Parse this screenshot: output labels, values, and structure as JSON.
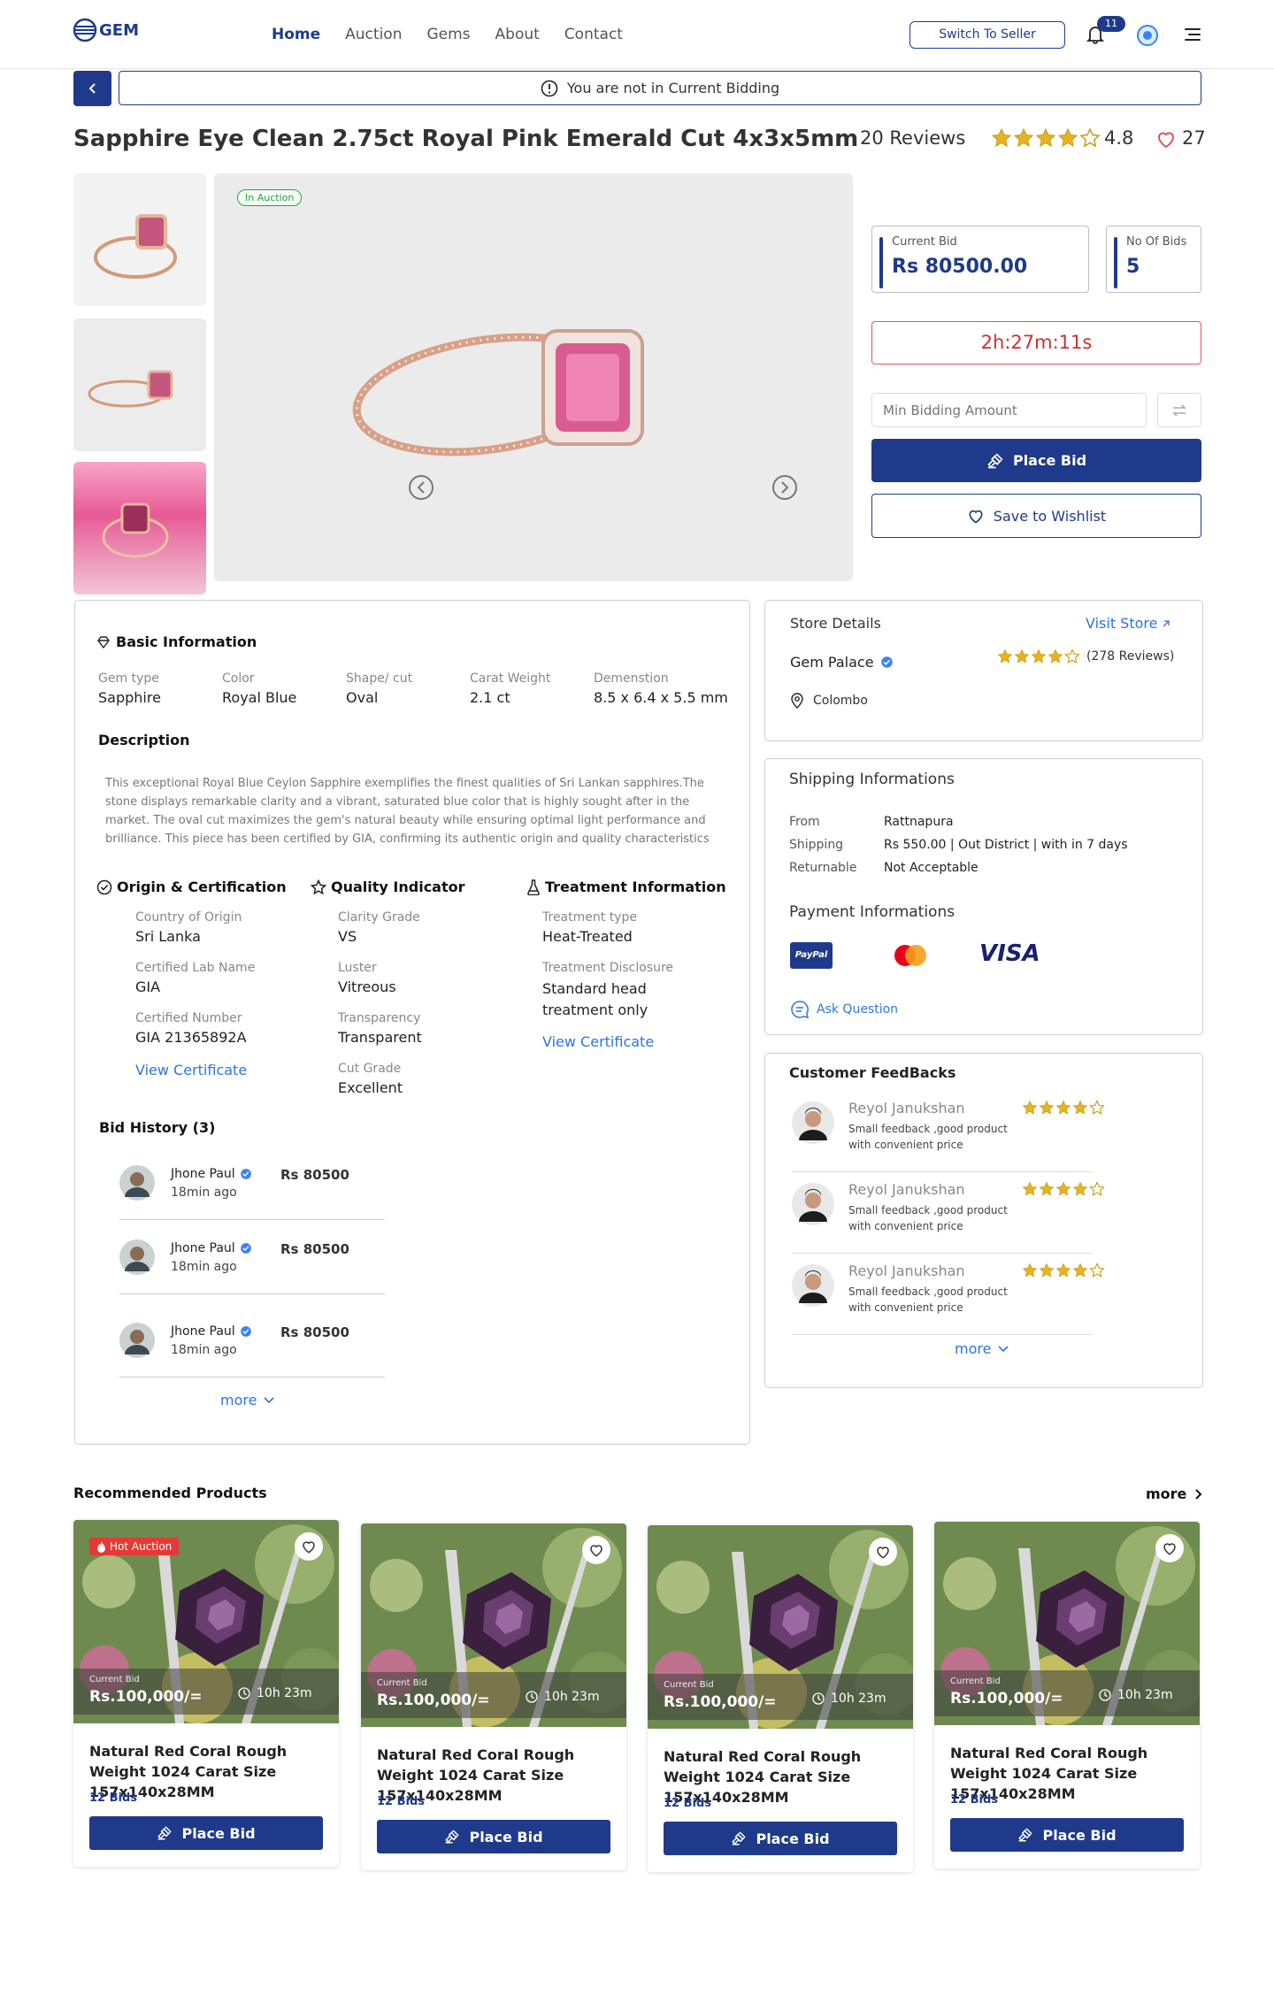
{
  "header": {
    "logo": "GEM",
    "nav": [
      "Home",
      "Auction",
      "Gems",
      "About",
      "Contact"
    ],
    "switch_seller": "Switch To Seller",
    "notification_count": "11"
  },
  "bidding_status": "You are not in Current Bidding",
  "product": {
    "title": "Sapphire Eye Clean 2.75ct  Royal Pink Emerald Cut 4x3x5mm",
    "reviews": "20 Reviews",
    "rating": "4.8",
    "likes": "27",
    "badge": "In Auction"
  },
  "bid": {
    "current_bid_label": "Current Bid",
    "current_bid": "Rs 80500.00",
    "no_bids_label": "No Of Bids",
    "no_bids": "5",
    "timer": "2h:27m:11s",
    "min_placeholder": "Min Bidding Amount",
    "place_bid": "Place Bid",
    "wishlist": "Save to Wishlist"
  },
  "basic": {
    "heading": "Basic Information",
    "fields": [
      {
        "label": "Gem type",
        "value": "Sapphire"
      },
      {
        "label": "Color",
        "value": "Royal Blue"
      },
      {
        "label": "Shape/ cut",
        "value": "Oval"
      },
      {
        "label": "Carat Weight",
        "value": "2.1 ct"
      },
      {
        "label": "Demenstion",
        "value": "8.5 x 6.4 x 5.5 mm"
      }
    ],
    "desc_heading": "Description",
    "description": "This exceptional Royal Blue Ceylon Sapphire exemplifies the finest qualities of Sri Lankan sapphires.The stone displays remarkable clarity and a vibrant, saturated blue color that is highly sought  after in the market. The oval cut maximizes the gem's natural beauty while ensuring    optimal light performance and brilliance. This piece has been certified by GIA, confirming  its authentic origin and quality characteristics"
  },
  "origin": {
    "heading": "Origin & Certification",
    "f1_label": "Country of Origin",
    "f1": "Sri Lanka",
    "f2_label": "Certified Lab Name",
    "f2": "GIA",
    "f3_label": "Certified Number",
    "f3": "GIA 21365892A",
    "link": "View Certificate"
  },
  "quality": {
    "heading": "Quality Indicator",
    "f1_label": "Clarity Grade",
    "f1": "VS",
    "f2_label": "Luster",
    "f2": "Vitreous",
    "f3_label": "Transparency",
    "f3": "Transparent",
    "f4_label": "Cut Grade",
    "f4": "Excellent"
  },
  "treatment": {
    "heading": "Treatment Information",
    "f1_label": "Treatment type",
    "f1": "Heat-Treated",
    "f2_label": "Treatment Disclosure",
    "f2a": "Standard head",
    "f2b": "treatment only",
    "link": "View Certificate"
  },
  "bid_history": {
    "heading": "Bid History (3)",
    "items": [
      {
        "name": "Jhone Paul",
        "time": "18min ago",
        "amount": "Rs 80500"
      },
      {
        "name": "Jhone Paul",
        "time": "18min ago",
        "amount": "Rs 80500"
      },
      {
        "name": "Jhone Paul",
        "time": "18min ago",
        "amount": "Rs 80500"
      }
    ],
    "more": "more"
  },
  "store": {
    "heading": "Store Details",
    "visit": "Visit Store",
    "name": "Gem Palace",
    "reviews": "(278 Reviews)",
    "location": "Colombo"
  },
  "shipping": {
    "heading": "Shipping Informations",
    "rows": [
      {
        "label": "From",
        "value": "Rattnapura"
      },
      {
        "label": "Shipping",
        "value": "Rs 550.00 | Out District | with in 7 days"
      },
      {
        "label": "Returnable",
        "value": "Not Acceptable"
      }
    ],
    "payment_heading": "Payment Informations",
    "paypal": "PayPal",
    "visa": "VISA",
    "ask": "Ask Question"
  },
  "feedback": {
    "heading": "Customer FeedBacks",
    "items": [
      {
        "name": "Reyol Janukshan",
        "l1": "Small feedback ,good product",
        "l2": "with convenient price"
      },
      {
        "name": "Reyol Janukshan",
        "l1": "Small feedback ,good product",
        "l2": "with convenient price"
      },
      {
        "name": "Reyol Janukshan",
        "l1": "Small feedback ,good product",
        "l2": "with convenient price"
      }
    ],
    "more": "more"
  },
  "recommended": {
    "heading": "Recommended Products",
    "more": "more",
    "hot": "Hot Auction",
    "items": [
      {
        "cb_label": "Current Bid",
        "price": "Rs.100,000/=",
        "time": "10h 23m",
        "title": "Natural Red Coral Rough Weight 1024 Carat Size 157x140x28MM",
        "bids": "12 Bids",
        "btn": "Place Bid"
      },
      {
        "cb_label": "Current Bid",
        "price": "Rs.100,000/=",
        "time": "10h 23m",
        "title": "Natural Red Coral Rough Weight 1024 Carat Size 157x140x28MM",
        "bids": "12 Bids",
        "btn": "Place Bid"
      },
      {
        "cb_label": "Current Bid",
        "price": "Rs.100,000/=",
        "time": "10h 23m",
        "title": "Natural Red Coral Rough Weight 1024 Carat Size 157x140x28MM",
        "bids": "12 Bids",
        "btn": "Place Bid"
      },
      {
        "cb_label": "Current Bid",
        "price": "Rs.100,000/=",
        "time": "10h 23m",
        "title": "Natural Red Coral Rough Weight 1024 Carat Size 157x140x28MM",
        "bids": "12 Bids",
        "btn": "Place Bid"
      }
    ]
  },
  "colors": {
    "primary": "#1f3a8a",
    "star": "#e6b422",
    "link": "#2f73e0",
    "danger": "#d32f2f",
    "success": "#2ea043"
  }
}
